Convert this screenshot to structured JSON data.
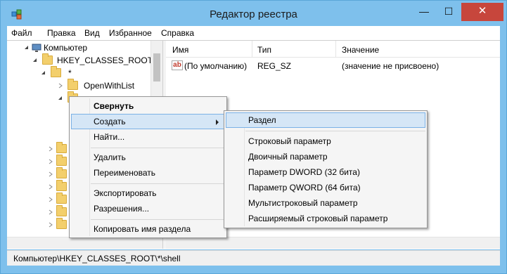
{
  "window": {
    "title": "Редактор реестра",
    "controls": {
      "minimize": "—",
      "maximize": "☐",
      "close": "✕"
    }
  },
  "menubar": [
    "Файл",
    "Правка",
    "Вид",
    "Избранное",
    "Справка"
  ],
  "tree": {
    "root": "Компьютер",
    "hkcr": "HKEY_CLASSES_ROOT",
    "star": "*",
    "openwithlist": "OpenWithList",
    "shell_partial": "shell"
  },
  "list": {
    "columns": [
      "Имя",
      "Тип",
      "Значение"
    ],
    "rows": [
      {
        "name": "(По умолчанию)",
        "type": "REG_SZ",
        "value": "(значение не присвоено)"
      }
    ]
  },
  "context_menu": {
    "items": [
      "Свернуть",
      "Создать",
      "Найти...",
      "Удалить",
      "Переименовать",
      "Экспортировать",
      "Разрешения...",
      "Копировать имя раздела"
    ]
  },
  "submenu": {
    "items": [
      "Раздел",
      "Строковый параметр",
      "Двоичный параметр",
      "Параметр DWORD (32 бита)",
      "Параметр QWORD (64 бита)",
      "Мультистроковый параметр",
      "Расширяемый строковый параметр"
    ]
  },
  "status": "Компьютер\\HKEY_CLASSES_ROOT\\*\\shell",
  "colors": {
    "titlebar": "#7ec0ec",
    "close": "#c7463c",
    "highlight": "#d5e6f6",
    "highlight_border": "#7bb1e6"
  }
}
